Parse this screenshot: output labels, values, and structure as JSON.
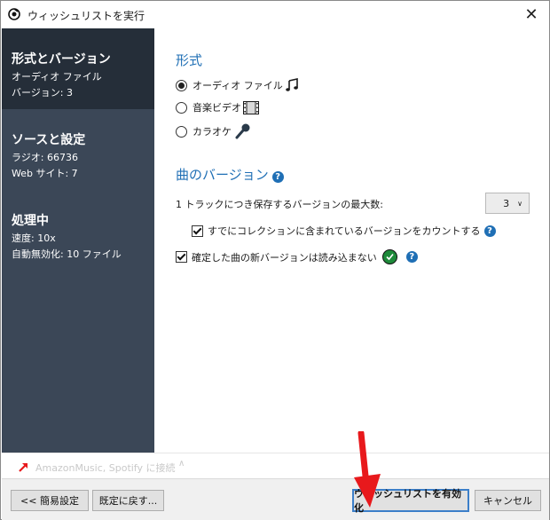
{
  "window": {
    "title": "ウィッシュリストを実行"
  },
  "sidebar": {
    "sections": [
      {
        "title": "形式とバージョン",
        "lines": [
          "オーディオ ファイル",
          "バージョン: 3"
        ]
      },
      {
        "title": "ソースと設定",
        "lines": [
          "ラジオ: 66736",
          "Web サイト: 7"
        ]
      },
      {
        "title": "処理中",
        "lines": [
          "速度: 10x",
          "自動無効化: 10 ファイル"
        ]
      }
    ]
  },
  "format": {
    "heading": "形式",
    "options": [
      {
        "label": "オーディオ ファイル",
        "checked": true,
        "icon": "music-note-icon"
      },
      {
        "label": "音楽ビデオ",
        "checked": false,
        "icon": "film-icon"
      },
      {
        "label": "カラオケ",
        "checked": false,
        "icon": "microphone-icon"
      }
    ]
  },
  "versions": {
    "heading": "曲のバージョン",
    "max_label": "1 トラックにつき保存するバージョンの最大数:",
    "max_value": "3",
    "count_existing_label": "すでにコレクションに含まれているバージョンをカウントする",
    "count_existing_checked": true,
    "skip_confirmed_label": "確定した曲の新バージョンは読み込まない",
    "skip_confirmed_checked": true
  },
  "connect": {
    "text": "AmazonMusic, Spotify に接続"
  },
  "footer": {
    "easy_settings": "<< 簡易設定",
    "reset_defaults": "既定に戻す...",
    "enable_wishlist": "ウィッシュリストを有効化",
    "cancel": "キャンセル"
  },
  "colors": {
    "sidebar_bg": "#3b4757",
    "sidebar_active": "#252e39",
    "accent": "#1f6fb5",
    "arrow": "#e8191c"
  }
}
